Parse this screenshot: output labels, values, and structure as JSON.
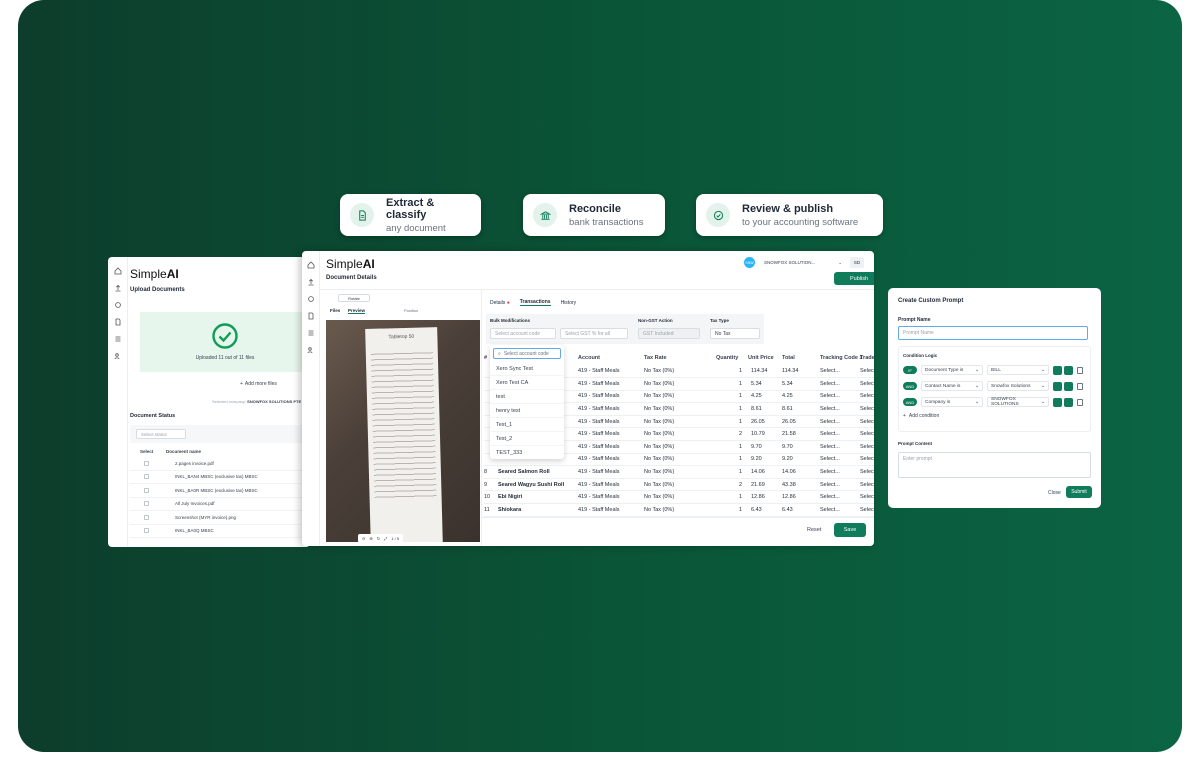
{
  "features": [
    {
      "title": "Extract & classify",
      "subtitle": "any document",
      "icon": "document-icon"
    },
    {
      "title": "Reconcile",
      "subtitle": "bank transactions",
      "icon": "bank-icon"
    },
    {
      "title": "Review & publish",
      "subtitle": "to your accounting software",
      "icon": "check-circle-icon"
    }
  ],
  "upload": {
    "logo_a": "Simple",
    "logo_b": "AI",
    "title": "Upload Documents",
    "status": "Uploaded 11 out of 11 files",
    "add_more": "Add more files",
    "company_label": "Selected company:",
    "company_name": "SNOWFOX SOLUTIONS PTE LTD",
    "doc_status": "Document Status",
    "filter": "Select status",
    "col_select": "Select",
    "col_name": "Document name",
    "files": [
      "2.pages invoice.pdf",
      "INKL_BAN4 MBSC (exclusive tax) MBSC",
      "INKL_BA0R MBSC (exclusive tax) MBSC",
      "All July Invoices.pdf",
      "Screenshot (MYR invoice).png",
      "INKL_BA0Q MBSC"
    ]
  },
  "main": {
    "logo_a": "Simple",
    "logo_b": "AI",
    "company": "SNOWFOX SOLUTION...",
    "avatar": "SD",
    "page_title": "Document Details",
    "publish": "Publish",
    "rotate": "Rotate",
    "tab_files": "Files",
    "tab_preview": "Preview",
    "position": "Position",
    "page_ind": "1 / 5",
    "receipt_title": "Tabletop 50",
    "tabs": [
      "Details",
      "Transactions",
      "History"
    ],
    "bulk_label": "Bulk Modifications",
    "acc_placeholder": "Select account code",
    "gst_placeholder": "Select GST % for all",
    "nongst_label": "Non-GST Action",
    "nongst_value": "GST Included",
    "taxtype_label": "Tax Type",
    "taxtype_value": "No Tax",
    "search_placeholder": "Select account code",
    "dropdown": [
      "Xero Sync Test",
      "Xero Test CA",
      "test",
      "henry test",
      "Test_1",
      "Test_2",
      "TEST_333"
    ],
    "headers": [
      "#",
      "Account",
      "Tax Rate",
      "Quantity",
      "Unit Price",
      "Total",
      "Tracking Code 1",
      "Trade",
      "A"
    ],
    "rows": [
      {
        "n": "",
        "desc": "",
        "acc": "419 - Staff Meals",
        "tax": "No Tax (0%)",
        "qty": "1",
        "price": "114.34",
        "total": "114.34"
      },
      {
        "n": "",
        "desc": "",
        "acc": "419 - Staff Meals",
        "tax": "No Tax (0%)",
        "qty": "1",
        "price": "5.34",
        "total": "5.34"
      },
      {
        "n": "",
        "desc": "",
        "acc": "419 - Staff Meals",
        "tax": "No Tax (0%)",
        "qty": "1",
        "price": "4.25",
        "total": "4.25"
      },
      {
        "n": "",
        "desc": "",
        "acc": "419 - Staff Meals",
        "tax": "No Tax (0%)",
        "qty": "1",
        "price": "8.61",
        "total": "8.61"
      },
      {
        "n": "",
        "desc": "",
        "acc": "419 - Staff Meals",
        "tax": "No Tax (0%)",
        "qty": "1",
        "price": "26.05",
        "total": "26.05"
      },
      {
        "n": "",
        "desc": "",
        "acc": "419 - Staff Meals",
        "tax": "No Tax (0%)",
        "qty": "2",
        "price": "10.79",
        "total": "21.58"
      },
      {
        "n": "",
        "desc": "",
        "acc": "419 - Staff Meals",
        "tax": "No Tax (0%)",
        "qty": "1",
        "price": "9.70",
        "total": "9.70"
      },
      {
        "n": "",
        "desc": "",
        "acc": "419 - Staff Meals",
        "tax": "No Tax (0%)",
        "qty": "1",
        "price": "9.20",
        "total": "9.20"
      },
      {
        "n": "8",
        "desc": "Seared Salmon Roll",
        "acc": "419 - Staff Meals",
        "tax": "No Tax (0%)",
        "qty": "1",
        "price": "14.06",
        "total": "14.06"
      },
      {
        "n": "9",
        "desc": "Seared Wagyu Sushi Roll",
        "acc": "419 - Staff Meals",
        "tax": "No Tax (0%)",
        "qty": "2",
        "price": "21.69",
        "total": "43.38"
      },
      {
        "n": "10",
        "desc": "Ebi Nigiri",
        "acc": "419 - Staff Meals",
        "tax": "No Tax (0%)",
        "qty": "1",
        "price": "12.86",
        "total": "12.86"
      },
      {
        "n": "11",
        "desc": "Shiokara",
        "acc": "419 - Staff Meals",
        "tax": "No Tax (0%)",
        "qty": "1",
        "price": "6.43",
        "total": "6.43"
      }
    ],
    "tracking_placeholder": "Select...",
    "trade_placeholder": "Select",
    "reset": "Reset",
    "save": "Save"
  },
  "prompt": {
    "title": "Create Custom Prompt",
    "name_label": "Prompt Name",
    "name_placeholder": "Prompt Name",
    "logic_label": "Condition Logic",
    "conditions": [
      {
        "op": "IF",
        "field": "Document Type is",
        "value": "BILL"
      },
      {
        "op": "AND",
        "field": "Contact Name is",
        "value": "Snowfox Solutions"
      },
      {
        "op": "AND",
        "field": "Company is",
        "value": "SNOWFOX SOLUTIONS"
      }
    ],
    "add_condition": "Add condition",
    "content_label": "Prompt Content",
    "content_placeholder": "Enter prompt",
    "close": "Close",
    "submit": "Submit"
  },
  "colors": {
    "accent": "#0f7c5c",
    "bg_dark": "#0d3d2c",
    "bg_light": "#0b6444"
  }
}
